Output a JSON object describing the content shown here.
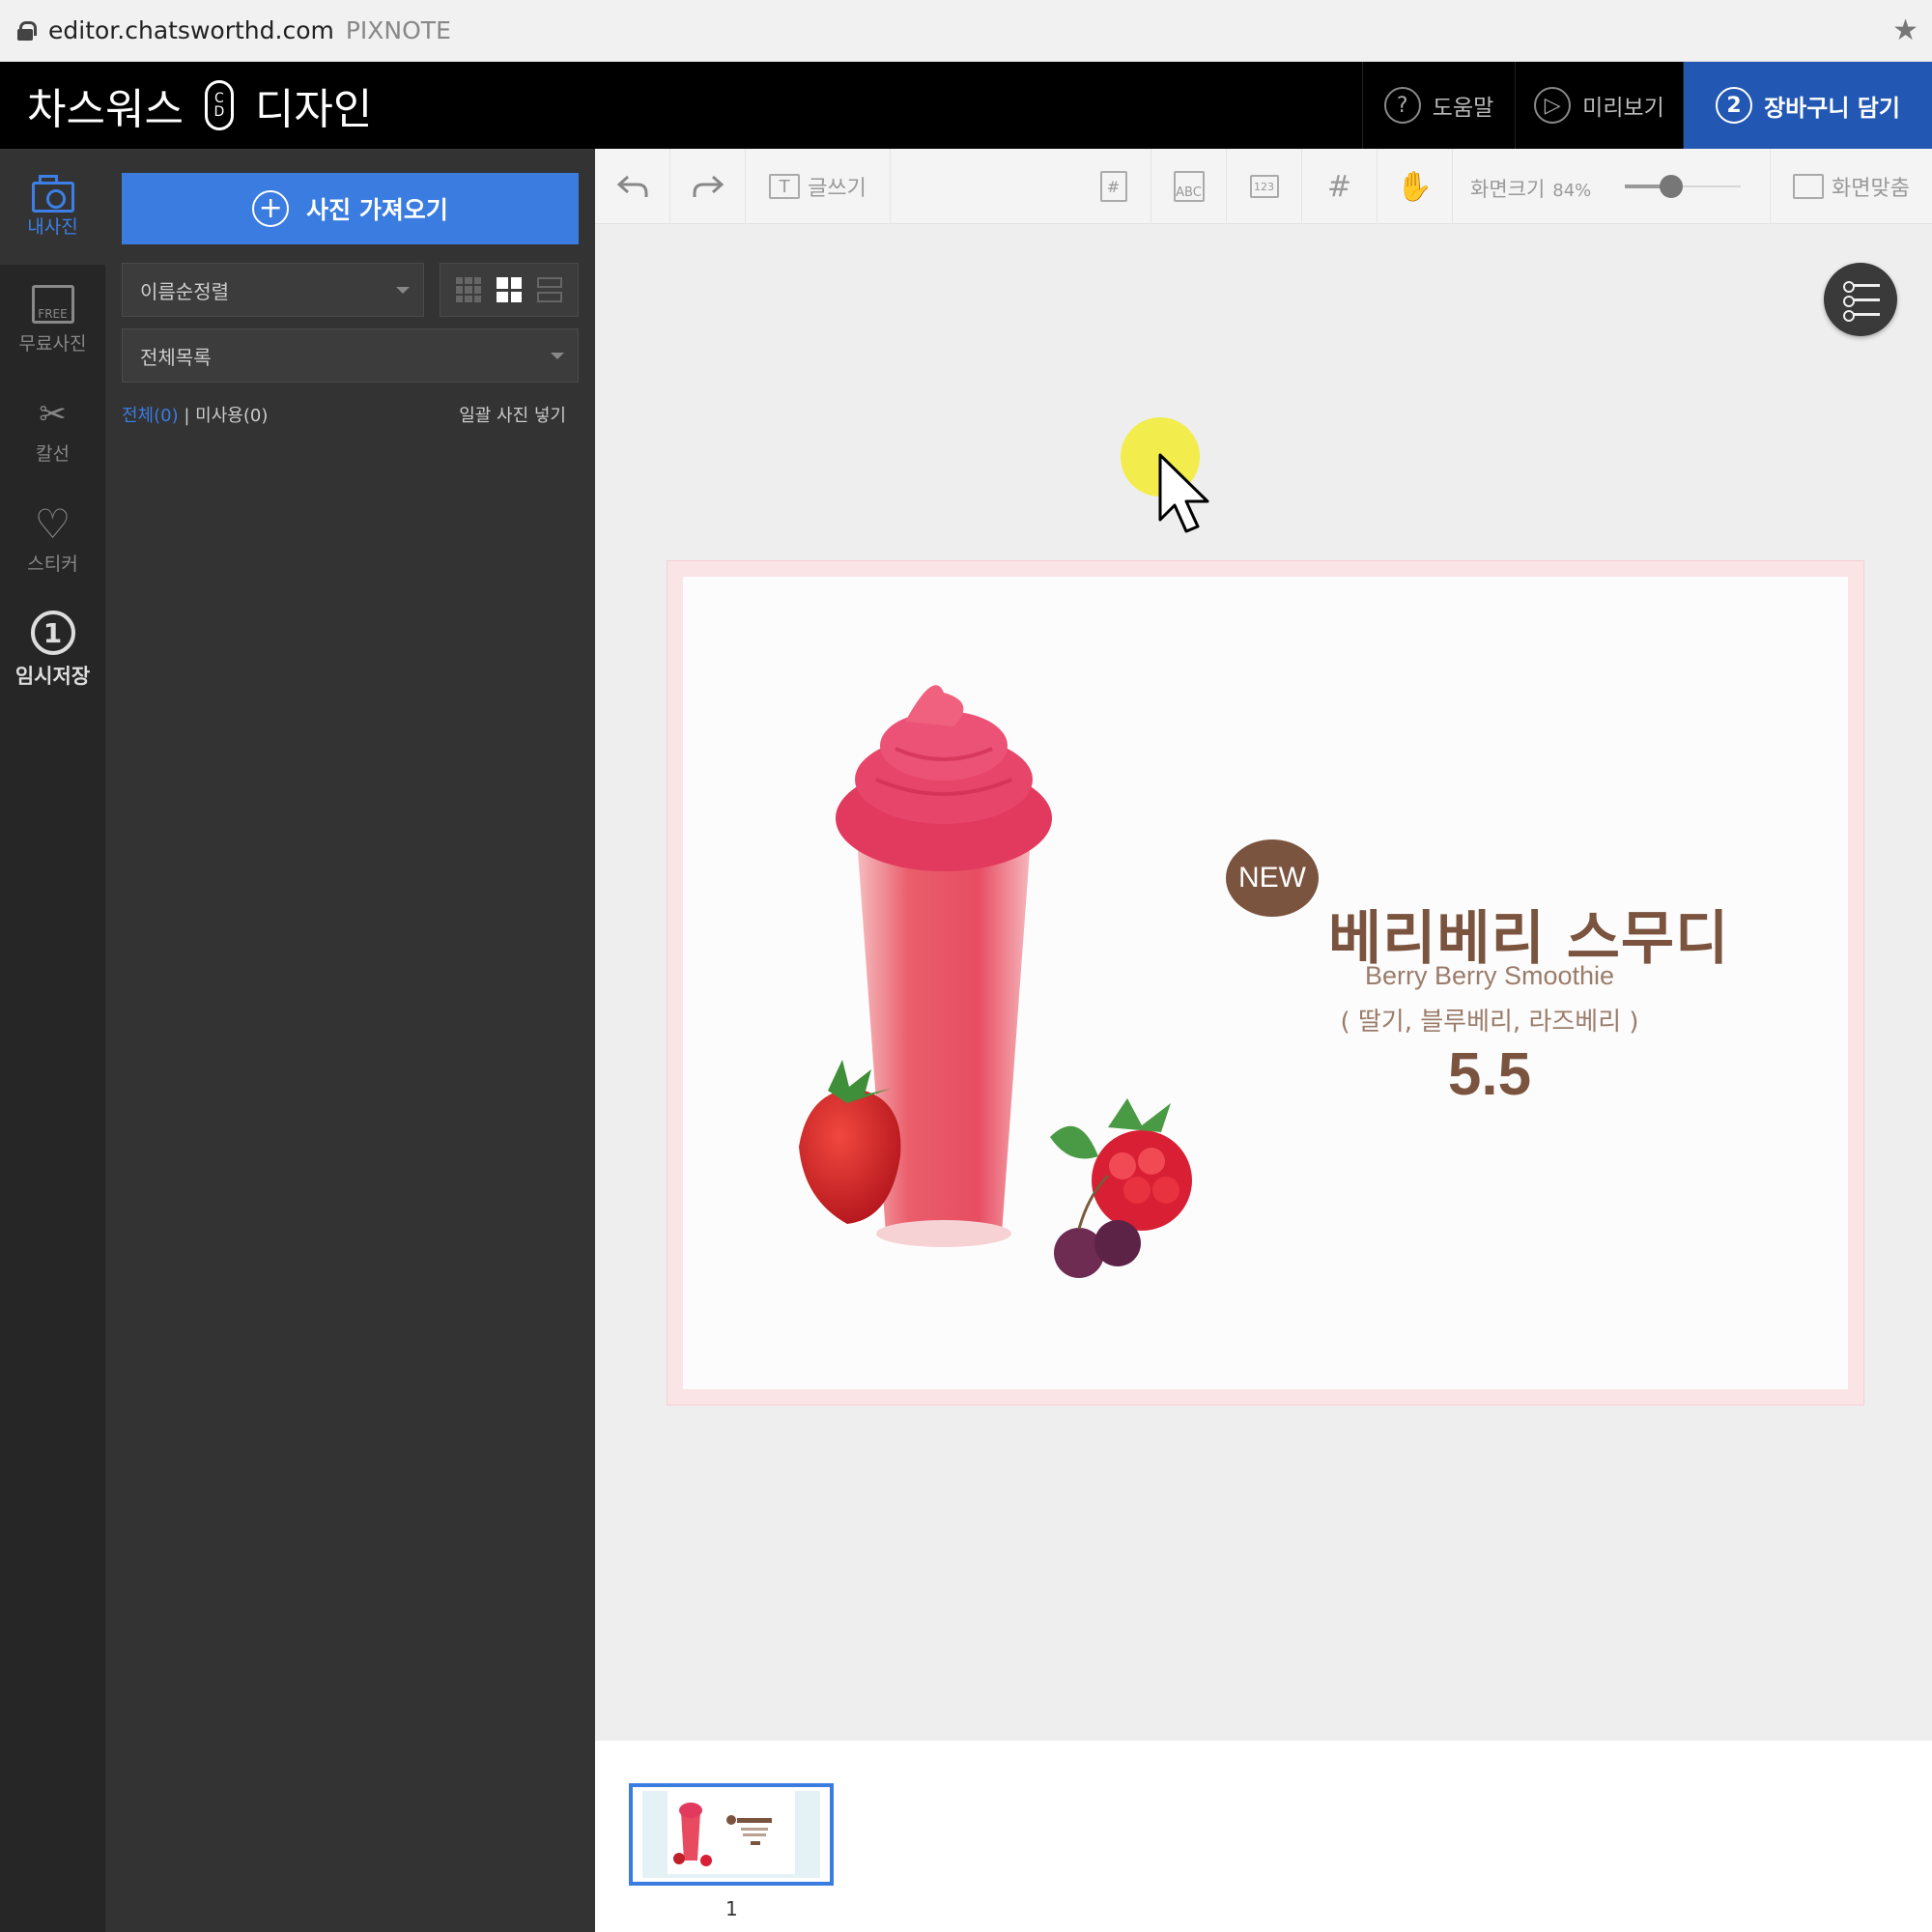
{
  "browser": {
    "url": "editor.chatsworthd.com",
    "site_name": "PIXNOTE"
  },
  "header": {
    "logo_left": "차스워스",
    "logo_badge_top": "C",
    "logo_badge_bottom": "D",
    "logo_right": "디자인",
    "help_label": "도움말",
    "preview_label": "미리보기",
    "cart_step": "2",
    "cart_label": "장바구니 담기"
  },
  "leftnav": {
    "items": [
      {
        "label": "내사진",
        "icon": "camera-icon",
        "active": true
      },
      {
        "label": "무료사진",
        "icon": "free-photo-icon",
        "icon_text": "FREE"
      },
      {
        "label": "칼선",
        "icon": "scissors-icon"
      },
      {
        "label": "스티커",
        "icon": "heart-icon"
      },
      {
        "label": "임시저장",
        "icon": "number-one-icon",
        "icon_text": "1"
      }
    ]
  },
  "panel": {
    "import_label": "사진 가져오기",
    "sort_value": "이름순정렬",
    "folder_value": "전체목록",
    "count_all": "전체(0)",
    "count_separator": "|",
    "count_unused": "미사용(0)",
    "bulk_insert": "일괄 사진 넣기"
  },
  "toolbar": {
    "text_label": "글쓰기",
    "abc_label": "ABC",
    "num_label": "123",
    "hash_label": "#",
    "zoom_label": "화면크기",
    "zoom_value": "84%",
    "zoom_fraction": 0.4,
    "fit_label": "화면맞춤"
  },
  "design": {
    "badge": "NEW",
    "title": "베리베리 스무디",
    "subtitle": "Berry Berry Smoothie",
    "ingredients": "( 딸기, 블루베리, 라즈베리 )",
    "price": "5.5"
  },
  "pages": {
    "current_page": "1"
  },
  "colors": {
    "accent_blue": "#3b7ce0",
    "cart_blue": "#2257b3",
    "brown": "#7b5440",
    "smoothie_red": "#e84a5f"
  }
}
